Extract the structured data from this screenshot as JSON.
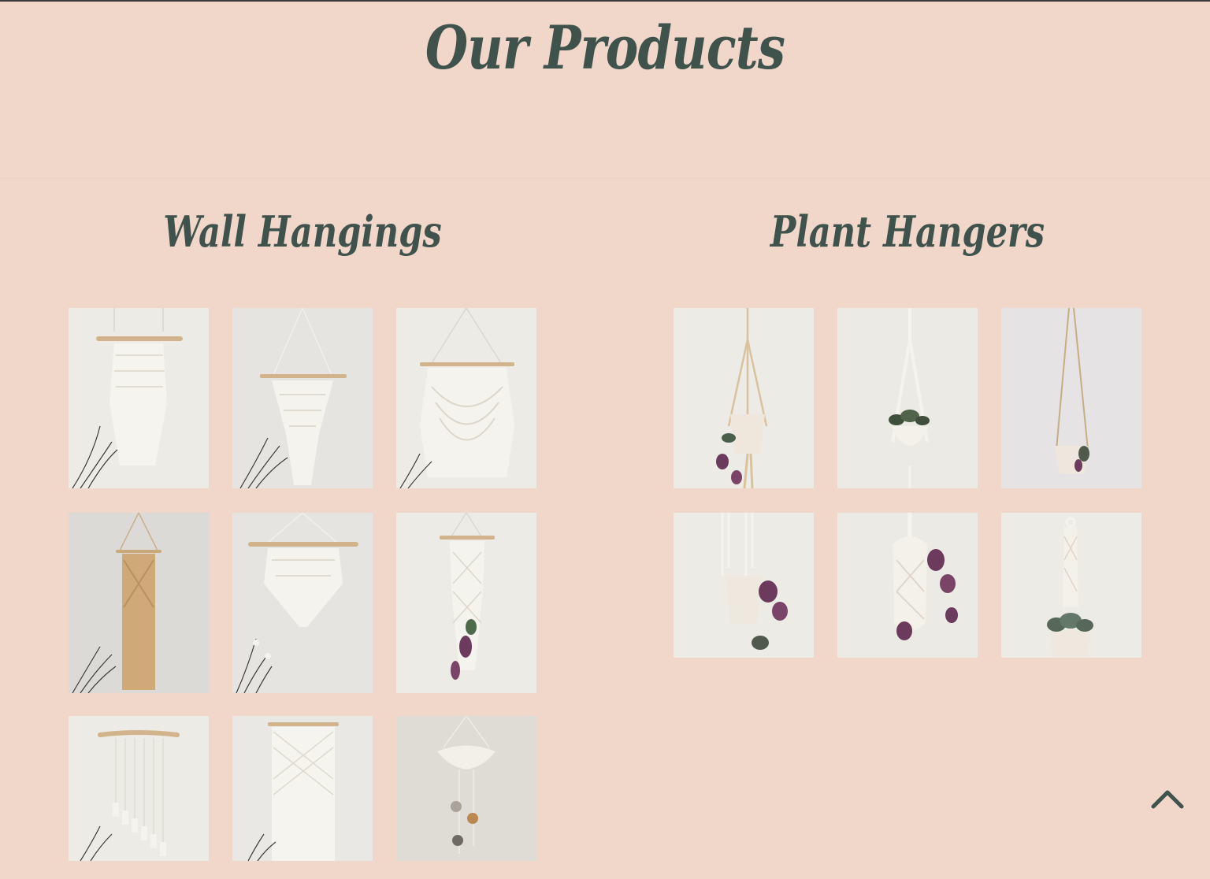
{
  "page": {
    "title": "Our Products"
  },
  "sections": [
    {
      "title": "Wall Hangings",
      "items": [
        {
          "icon": "macrame-wall-hanging-image"
        },
        {
          "icon": "macrame-wall-hanging-image"
        },
        {
          "icon": "macrame-wall-hanging-image"
        },
        {
          "icon": "macrame-wall-hanging-image"
        },
        {
          "icon": "macrame-wall-hanging-image"
        },
        {
          "icon": "macrame-wall-hanging-image"
        },
        {
          "icon": "macrame-wall-hanging-image"
        },
        {
          "icon": "macrame-wall-hanging-image"
        },
        {
          "icon": "macrame-wall-hanging-image"
        }
      ]
    },
    {
      "title": "Plant Hangers",
      "items": [
        {
          "icon": "macrame-plant-hanger-image"
        },
        {
          "icon": "macrame-plant-hanger-image"
        },
        {
          "icon": "macrame-plant-hanger-image"
        },
        {
          "icon": "macrame-plant-hanger-image"
        },
        {
          "icon": "macrame-plant-hanger-image"
        },
        {
          "icon": "macrame-plant-hanger-image"
        }
      ]
    }
  ],
  "scroll_top": {
    "icon": "chevron-up-icon"
  },
  "colors": {
    "background": "#f1d6ca",
    "heading": "#3f524c",
    "photo_bg": "#ece9e3"
  }
}
